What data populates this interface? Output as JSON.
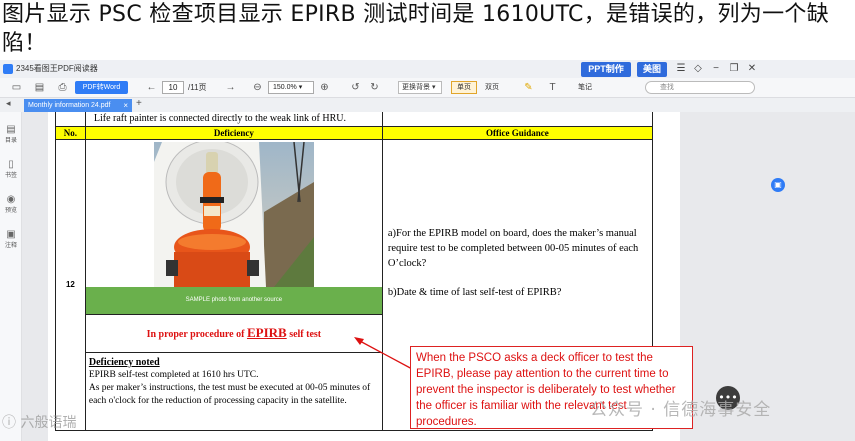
{
  "caption": "图片显示 PSC 检查项目显示 EPIRB 测试时间是 1610UTC，是错误的，列为一个缺陷！",
  "app": {
    "title": "2345看图王PDF阅读器",
    "ppt_label": "PPT制作",
    "meitu_label": "美图"
  },
  "toolbar": {
    "pdf2word_label": "PDF转Word",
    "page_current": "10",
    "page_total": "/11页",
    "zoom": "150.0%",
    "bg_label": "更换背景",
    "single_label": "单页",
    "double_label": "双页",
    "notes_label": "笔记",
    "search_placeholder": "查找"
  },
  "tab": {
    "label": "Monthly information 24.pdf",
    "close": "×",
    "add": "+"
  },
  "sidebar": {
    "items": [
      {
        "label": "目录",
        "icon": "list-icon"
      },
      {
        "label": "书签",
        "icon": "bookmark-icon"
      },
      {
        "label": "预览",
        "icon": "eye-icon"
      },
      {
        "label": "注释",
        "icon": "note-icon"
      }
    ]
  },
  "document": {
    "top_text": "Life raft painter is connected directly to the weak link of HRU.",
    "headers": {
      "no": "No.",
      "deficiency": "Deficiency",
      "guidance": "Office Guidance"
    },
    "row_number": "12",
    "sample_caption": "SAMPLE photo from another source",
    "procedure_pre": "In proper procedure of ",
    "procedure_key": "EPIRB",
    "procedure_post": " self test",
    "noted_title": "Deficiency noted",
    "noted_line1": "EPIRB self-test completed at 1610 hrs UTC.",
    "noted_line2": "As per maker’s instructions, the test must be executed at 00-05 minutes of each o'clock for the reduction of processing capacity in the satellite.",
    "guidance_q1": "a)For the EPIRB model on board, does the maker’s manual require test to be completed between 00-05 minutes of each O’clock?",
    "guidance_q2": "b)Date & time of last self-test of EPIRB?"
  },
  "callout": {
    "text": "When the PSCO asks a deck officer to test the EPIRB, please pay attention to the current time to prevent the inspector is deliberately to test whether the officer is familiar with the relevant test procedures."
  },
  "watermarks": {
    "left": "ⓘ 六般语瑞",
    "right": "公众号 · 信德海事安全"
  },
  "colors": {
    "header_yellow": "#ffff00",
    "accent_red": "#dd1111",
    "photo_bar_green": "#6ab04c",
    "app_blue": "#2f7cf6"
  }
}
